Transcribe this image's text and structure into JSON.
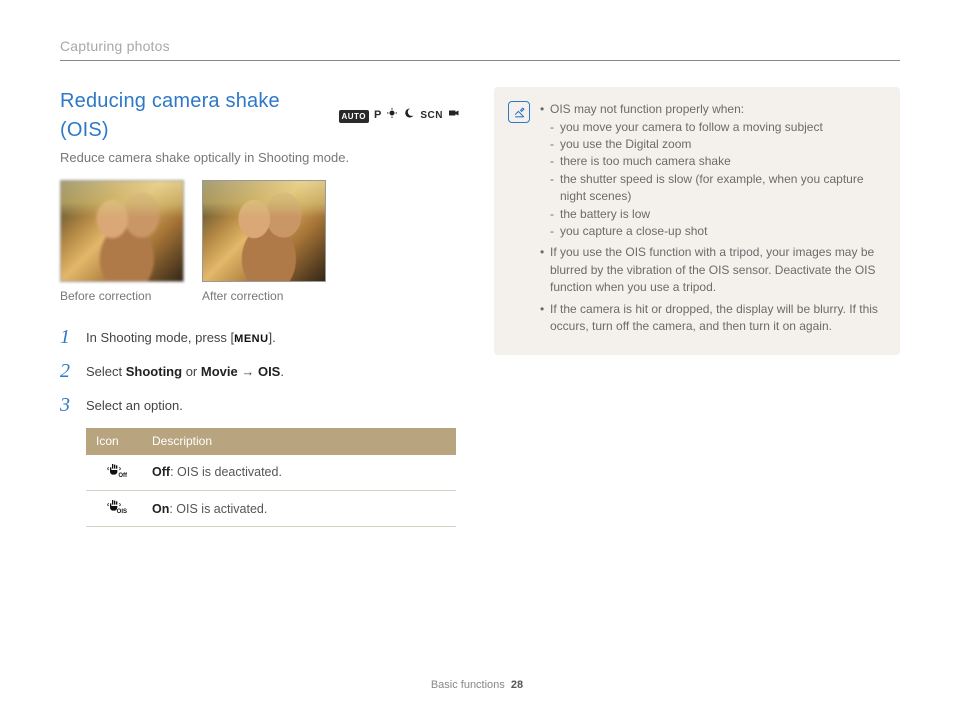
{
  "breadcrumb": "Capturing photos",
  "title": "Reducing camera shake (OIS)",
  "mode_icons": {
    "auto": "AUTO",
    "p": "P",
    "scn": "SCN"
  },
  "subtitle": "Reduce camera shake optically in Shooting mode.",
  "photos": {
    "before_caption": "Before correction",
    "after_caption": "After correction"
  },
  "steps": [
    {
      "num": "1",
      "prefix": "In Shooting mode, press [",
      "menu": "MENU",
      "suffix": "]."
    },
    {
      "num": "2",
      "text_parts": [
        "Select ",
        "Shooting",
        " or ",
        "Movie",
        " → ",
        "OIS",
        "."
      ]
    },
    {
      "num": "3",
      "plain": "Select an option."
    }
  ],
  "table": {
    "head_icon": "Icon",
    "head_desc": "Description",
    "rows": [
      {
        "sub": "Off",
        "bold": "Off",
        "rest": ": OIS is deactivated."
      },
      {
        "sub": "OIS",
        "bold": "On",
        "rest": ": OIS is activated."
      }
    ]
  },
  "notes": {
    "b1": "OIS may not function properly when:",
    "b1_sub": [
      "you move your camera to follow a moving subject",
      "you use the Digital zoom",
      "there is too much camera shake",
      "the shutter speed is slow (for example, when you capture night scenes)",
      "the battery is low",
      "you capture a close-up shot"
    ],
    "b2": "If you use the OIS function with a tripod, your images may be blurred by the vibration of the OIS sensor. Deactivate the OIS function when you use a tripod.",
    "b3": "If the camera is hit or dropped, the display will be blurry. If this occurs, turn off the camera, and then turn it on again."
  },
  "footer": {
    "section": "Basic functions",
    "page": "28"
  }
}
